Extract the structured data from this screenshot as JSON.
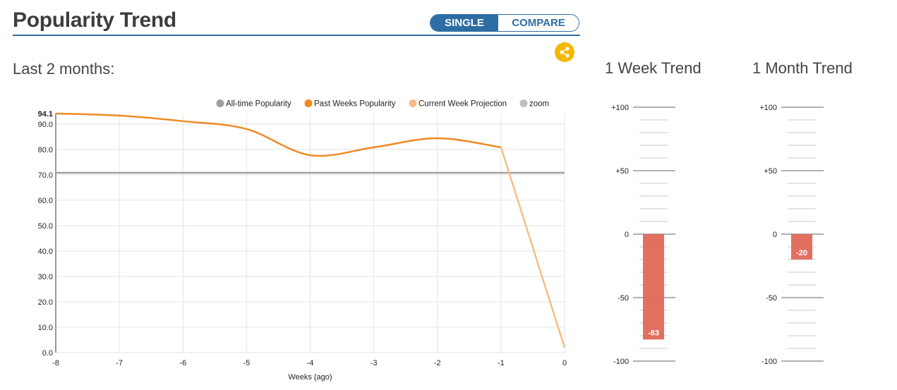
{
  "header": {
    "title": "Popularity Trend",
    "toggle": {
      "single_label": "SINGLE",
      "compare_label": "COMPARE",
      "selected": "SINGLE"
    },
    "share_icon": "share-icon"
  },
  "subtitle": "Last 2 months:",
  "colors": {
    "accent": "#2e6da4",
    "all_time": "#a0a0a0",
    "past_weeks": "#f08a24",
    "projection": "#f7bd85",
    "zoom": "#bdbdbd",
    "negative_bar": "#e06858",
    "share": "#f5b800"
  },
  "chart_data": {
    "type": "line",
    "title": "",
    "xlabel": "Weeks (ago)",
    "ylabel": "",
    "xlim": [
      -8,
      0
    ],
    "ylim": [
      0,
      94.1
    ],
    "x_ticks": [
      "-8",
      "-7",
      "-6",
      "-5",
      "-4",
      "-3",
      "-2",
      "-1",
      "0"
    ],
    "y_ticks": [
      "0.0",
      "10.0",
      "20.0",
      "30.0",
      "40.0",
      "50.0",
      "60.0",
      "70.0",
      "80.0",
      "90.0",
      "94.1"
    ],
    "grid": true,
    "legend_position": "top",
    "legend": [
      "All-time Popularity",
      "Past Weeks Popularity",
      "Current Week Projection",
      "zoom"
    ],
    "series": [
      {
        "name": "All-time Popularity",
        "x": [
          -8,
          0
        ],
        "values": [
          70.8,
          70.8
        ]
      },
      {
        "name": "Past Weeks Popularity",
        "x": [
          -8,
          -7,
          -6,
          -5,
          -4,
          -3,
          -2,
          -1
        ],
        "values": [
          94.1,
          93.3,
          91.1,
          88.0,
          77.7,
          80.8,
          84.4,
          80.8
        ]
      },
      {
        "name": "Current Week Projection",
        "x": [
          -1,
          0
        ],
        "values": [
          80.8,
          2.0
        ]
      }
    ]
  },
  "trends": [
    {
      "title": "1 Week Trend",
      "value": -83,
      "label": "-83",
      "ticks": [
        "+100",
        "+50",
        "0",
        "-50",
        "-100"
      ]
    },
    {
      "title": "1 Month Trend",
      "value": -20,
      "label": "-20",
      "ticks": [
        "+100",
        "+50",
        "0",
        "-50",
        "-100"
      ]
    }
  ]
}
